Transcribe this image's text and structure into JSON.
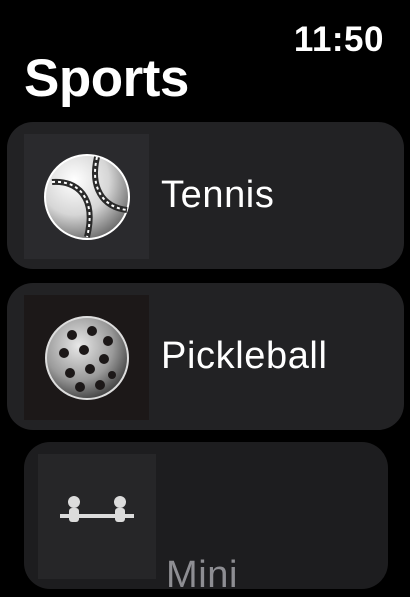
{
  "status": {
    "time": "11:50"
  },
  "header": {
    "title": "Sports"
  },
  "list": {
    "items": [
      {
        "label": "Tennis",
        "icon": "tennis-ball-icon"
      },
      {
        "label": "Pickleball",
        "icon": "pickleball-icon"
      },
      {
        "label": "Mini",
        "icon": "foosball-icon"
      }
    ]
  }
}
